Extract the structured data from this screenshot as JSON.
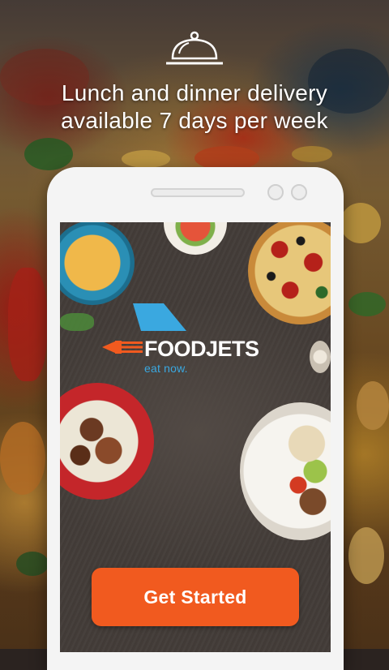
{
  "header": {
    "icon": "cloche-icon",
    "headline_line1": "Lunch and dinner delivery",
    "headline_line2": "available 7 days per week"
  },
  "logo": {
    "name": "FOODJETS",
    "tagline": "eat now.",
    "colors": {
      "wing": "#3aa8e0",
      "fork": "#f15a1f",
      "text": "#ffffff"
    }
  },
  "cta": {
    "label": "Get Started",
    "color": "#f15a1f"
  }
}
